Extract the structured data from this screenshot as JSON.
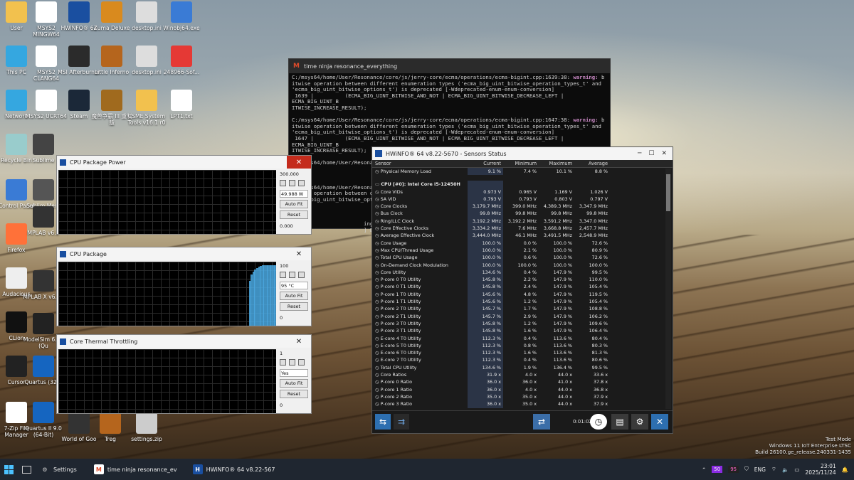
{
  "desktop_icons": [
    {
      "label": "User",
      "icon": "folder-icon"
    },
    {
      "label": "MSYS2 MINGW64",
      "icon": "msys-icon"
    },
    {
      "label": "HWiNFO® 64",
      "icon": "hwinfo-icon"
    },
    {
      "label": "Zuma Deluxe",
      "icon": "zuma-icon"
    },
    {
      "label": "desktop.ini",
      "icon": "file-icon"
    },
    {
      "label": "Winobj64.exe",
      "icon": "gear-icon"
    },
    {
      "label": "This PC",
      "icon": "monitor-icon"
    },
    {
      "label": "MSYS2 CLANG64",
      "icon": "msys-icon"
    },
    {
      "label": "MSI Afterburner",
      "icon": "afterburner-icon"
    },
    {
      "label": "Little Inferno",
      "icon": "game-icon"
    },
    {
      "label": "desktop.ini",
      "icon": "file-icon"
    },
    {
      "label": "248966-Sof...",
      "icon": "pdf-icon"
    },
    {
      "label": "Network",
      "icon": "network-icon"
    },
    {
      "label": "MSYS2 UCRT64",
      "icon": "msys-icon"
    },
    {
      "label": "Steam",
      "icon": "steam-icon"
    },
    {
      "label": "魔兽争霸 III 重制版",
      "icon": "warcraft-icon"
    },
    {
      "label": "CSME System Tools v16.1 r0",
      "icon": "folder-icon"
    },
    {
      "label": "LPT1.txt",
      "icon": "text-file-icon"
    },
    {
      "label": "Recycle Bin",
      "icon": "recycle-bin-icon"
    },
    {
      "label": "Sublime",
      "icon": "sublime-icon"
    },
    {
      "label": "Control Panel",
      "icon": "control-panel-icon"
    },
    {
      "label": "Sublim Merg",
      "icon": "sublime-merge-icon"
    },
    {
      "label": "Firefox",
      "icon": "firefox-icon"
    },
    {
      "label": "MPLAB v6.2",
      "icon": "mplab-icon"
    },
    {
      "label": "Audacious",
      "icon": "audacious-icon"
    },
    {
      "label": "MPLAB X v6.25",
      "icon": "mplab-icon"
    },
    {
      "label": "CLion",
      "icon": "clion-icon"
    },
    {
      "label": "ModelSim 6.4a (Qu",
      "icon": "modelsim-icon"
    },
    {
      "label": "Cursor",
      "icon": "cursor-icon"
    },
    {
      "label": "Quartus (32-B",
      "icon": "quartus-icon"
    },
    {
      "label": "7-Zip File Manager",
      "icon": "7zip-icon"
    },
    {
      "label": "Quartus II 9.0 (64-Bit)",
      "icon": "quartus-icon"
    },
    {
      "label": "World of Goo",
      "icon": "goo-icon"
    },
    {
      "label": "Treg",
      "icon": "game-icon"
    },
    {
      "label": "settings.zip",
      "icon": "zip-icon"
    }
  ],
  "terminal": {
    "title": "time ninja resonance_everything",
    "lines": [
      "C:/msys64/home/User/Resonance/core/js/jerry-core/ecma/operations/ecma-bigint.cpp:1639:38: warning: b",
      "itwise operation between different enumeration types ('ecma_big_uint_bitwise_operation_types_t' and",
      "'ecma_big_uint_bitwise_options_t') is deprecated [-Wdeprecated-enum-enum-conversion]",
      " 1639 |          (ECMA_BIG_UINT_BITWISE_AND_NOT | ECMA_BIG_UINT_BITWISE_DECREASE_LEFT | ECMA_BIG_UINT_B",
      "ITWISE_INCREASE_RESULT);",
      "",
      "C:/msys64/home/User/Resonance/core/js/jerry-core/ecma/operations/ecma-bigint.cpp:1647:38: warning: b",
      "itwise operation between different enumeration types ('ecma_big_uint_bitwise_operation_types_t' and",
      "'ecma_big_uint_bitwise_options_t') is deprecated [-Wdeprecated-enum-enum-conversion]",
      " 1647 |          (ECMA_BIG_UINT_BITWISE_AND_NOT | ECMA_BIG_UINT_BITWISE_DECREASE_LEFT | ECMA_BIG_UINT_B",
      "ITWISE_INCREASE_RESULT);",
      "",
      "C:/msys64/home/User/Resonance",
      "                             (ECMA_BIG_UINT_B",
      "                            REASE_RESULT);",
      "",
      "C:/msys64/home/User/Resonan",
      "itwise operation between d",
      "'ecma_big_uint_bitwise_opt",
      "                              (ECMA_BIG_UINT_B",
      "                             REASE_RESULT);",
      "",
      "                       ings generated.",
      "                       ] Building CXX obje"
    ]
  },
  "graphs": [
    {
      "title": "CPU Package Power",
      "top": "300.000",
      "current": "49.988 W",
      "bottom": "0.000",
      "autofit": "Auto Fit",
      "reset": "Reset",
      "series": [
        0,
        0,
        0,
        0,
        0,
        0,
        0,
        0,
        0,
        0,
        0,
        0,
        0,
        0,
        0,
        0,
        0,
        0,
        0,
        0
      ]
    },
    {
      "title": "CPU Package",
      "top": "100",
      "current": "95 °C",
      "bottom": "0",
      "autofit": "Auto Fit",
      "reset": "Reset",
      "series": [
        0,
        0,
        0,
        0,
        0,
        0,
        0,
        0,
        0,
        0,
        0,
        0,
        0,
        0,
        0,
        0,
        0,
        0,
        0,
        0,
        0,
        0,
        0,
        0,
        0,
        0,
        0,
        0,
        0,
        0,
        0,
        0,
        0,
        0,
        0,
        0,
        0,
        0,
        0,
        0,
        0,
        0,
        0,
        0,
        0,
        0,
        0,
        0,
        0,
        0,
        0,
        0,
        0,
        0,
        0,
        0,
        0,
        0,
        0,
        0,
        0,
        0,
        0,
        0,
        0,
        0,
        0,
        0,
        0,
        0,
        0,
        0,
        70,
        80,
        85,
        88,
        90,
        92,
        93,
        94,
        94,
        95,
        95,
        95,
        95,
        95,
        95
      ]
    },
    {
      "title": "Core Thermal Throttling",
      "top": "1",
      "current": "Yes",
      "bottom": "0",
      "autofit": "Auto Fit",
      "reset": "Reset",
      "series": []
    }
  ],
  "hwinfo": {
    "title": "HWiNFO® 64 v8.22-5670 - Sensors Status",
    "columns": [
      "Sensor",
      "Current",
      "Minimum",
      "Maximum",
      "Average"
    ],
    "rows": [
      {
        "name": "Physical Memory Load",
        "cur": "9.1 %",
        "min": "7.4 %",
        "max": "10.1 %",
        "avg": "8.8 %"
      },
      {
        "blank": true
      },
      {
        "name": "CPU [#0]: Intel Core i5-12450H",
        "group": true,
        "cur": "",
        "min": "",
        "max": "",
        "avg": ""
      },
      {
        "name": "Core VIDs",
        "cur": "0.973 V",
        "min": "0.965 V",
        "max": "1.169 V",
        "avg": "1.026 V"
      },
      {
        "name": "SA VID",
        "cur": "0.793 V",
        "min": "0.793 V",
        "max": "0.803 V",
        "avg": "0.797 V"
      },
      {
        "name": "Core Clocks",
        "cur": "3,179.7 MHz",
        "min": "399.0 MHz",
        "max": "4,389.3 MHz",
        "avg": "3,347.9 MHz"
      },
      {
        "name": "Bus Clock",
        "cur": "99.8 MHz",
        "min": "99.8 MHz",
        "max": "99.8 MHz",
        "avg": "99.8 MHz"
      },
      {
        "name": "Ring/LLC Clock",
        "cur": "3,192.2 MHz",
        "min": "3,192.2 MHz",
        "max": "3,591.2 MHz",
        "avg": "3,347.0 MHz"
      },
      {
        "name": "Core Effective Clocks",
        "cur": "3,334.2 MHz",
        "min": "7.6 MHz",
        "max": "3,668.8 MHz",
        "avg": "2,457.7 MHz"
      },
      {
        "name": "Average Effective Clock",
        "cur": "3,444.0 MHz",
        "min": "46.1 MHz",
        "max": "3,491.5 MHz",
        "avg": "2,548.9 MHz"
      },
      {
        "name": "Core Usage",
        "cur": "100.0 %",
        "min": "0.0 %",
        "max": "100.0 %",
        "avg": "72.6 %"
      },
      {
        "name": "Max CPU/Thread Usage",
        "cur": "100.0 %",
        "min": "2.1 %",
        "max": "100.0 %",
        "avg": "80.9 %"
      },
      {
        "name": "Total CPU Usage",
        "cur": "100.0 %",
        "min": "0.6 %",
        "max": "100.0 %",
        "avg": "72.6 %"
      },
      {
        "name": "On-Demand Clock Modulation",
        "cur": "100.0 %",
        "min": "100.0 %",
        "max": "100.0 %",
        "avg": "100.0 %"
      },
      {
        "name": "Core Utility",
        "cur": "134.6 %",
        "min": "0.4 %",
        "max": "147.9 %",
        "avg": "99.5 %"
      },
      {
        "name": "P-core 0 T0 Utility",
        "cur": "145.8 %",
        "min": "2.2 %",
        "max": "147.9 %",
        "avg": "110.0 %"
      },
      {
        "name": "P-core 0 T1 Utility",
        "cur": "145.8 %",
        "min": "2.4 %",
        "max": "147.9 %",
        "avg": "105.4 %"
      },
      {
        "name": "P-core 1 T0 Utility",
        "cur": "145.6 %",
        "min": "4.8 %",
        "max": "147.9 %",
        "avg": "119.5 %"
      },
      {
        "name": "P-core 1 T1 Utility",
        "cur": "145.6 %",
        "min": "1.2 %",
        "max": "147.9 %",
        "avg": "105.4 %"
      },
      {
        "name": "P-core 2 T0 Utility",
        "cur": "145.7 %",
        "min": "1.7 %",
        "max": "147.9 %",
        "avg": "108.8 %"
      },
      {
        "name": "P-core 2 T1 Utility",
        "cur": "145.7 %",
        "min": "2.9 %",
        "max": "147.9 %",
        "avg": "106.2 %"
      },
      {
        "name": "P-core 3 T0 Utility",
        "cur": "145.8 %",
        "min": "1.2 %",
        "max": "147.9 %",
        "avg": "109.6 %"
      },
      {
        "name": "P-core 3 T1 Utility",
        "cur": "145.8 %",
        "min": "1.6 %",
        "max": "147.9 %",
        "avg": "106.4 %"
      },
      {
        "name": "E-core 4 T0 Utility",
        "cur": "112.3 %",
        "min": "0.4 %",
        "max": "113.6 %",
        "avg": "80.4 %"
      },
      {
        "name": "E-core 5 T0 Utility",
        "cur": "112.3 %",
        "min": "0.8 %",
        "max": "113.6 %",
        "avg": "80.3 %"
      },
      {
        "name": "E-core 6 T0 Utility",
        "cur": "112.3 %",
        "min": "1.6 %",
        "max": "113.6 %",
        "avg": "81.3 %"
      },
      {
        "name": "E-core 7 T0 Utility",
        "cur": "112.3 %",
        "min": "0.4 %",
        "max": "113.6 %",
        "avg": "80.6 %"
      },
      {
        "name": "Total CPU Utility",
        "cur": "134.6 %",
        "min": "1.9 %",
        "max": "136.4 %",
        "avg": "99.5 %"
      },
      {
        "name": "Core Ratios",
        "cur": "31.9 x",
        "min": "4.0 x",
        "max": "44.0 x",
        "avg": "33.6 x"
      },
      {
        "name": "P-core 0 Ratio",
        "cur": "36.0 x",
        "min": "36.0 x",
        "max": "41.0 x",
        "avg": "37.8 x"
      },
      {
        "name": "P-core 1 Ratio",
        "cur": "36.0 x",
        "min": "4.0 x",
        "max": "44.0 x",
        "avg": "36.8 x"
      },
      {
        "name": "P-core 2 Ratio",
        "cur": "35.0 x",
        "min": "35.0 x",
        "max": "44.0 x",
        "avg": "37.9 x"
      },
      {
        "name": "P-core 3 Ratio",
        "cur": "36.0 x",
        "min": "35.0 x",
        "max": "44.0 x",
        "avg": "37.9 x"
      }
    ],
    "timer": "0:01:02"
  },
  "taskbar": {
    "items": [
      {
        "label": "Settings",
        "icon": "gear-icon"
      },
      {
        "label": "time ninja resonance_ev",
        "icon": "msys-icon"
      },
      {
        "label": "HWiNFO® 64 v8.22-567",
        "icon": "hwinfo-icon"
      }
    ],
    "tray": {
      "badge1": "50",
      "badge2": "95",
      "lang": "ENG",
      "time": "23:01",
      "date": "2025/11/24"
    }
  },
  "watermark": [
    "Test Mode",
    "Windows 11 IoT Enterprise LTSC",
    "Build 26100.ge_release.240331-1435"
  ]
}
